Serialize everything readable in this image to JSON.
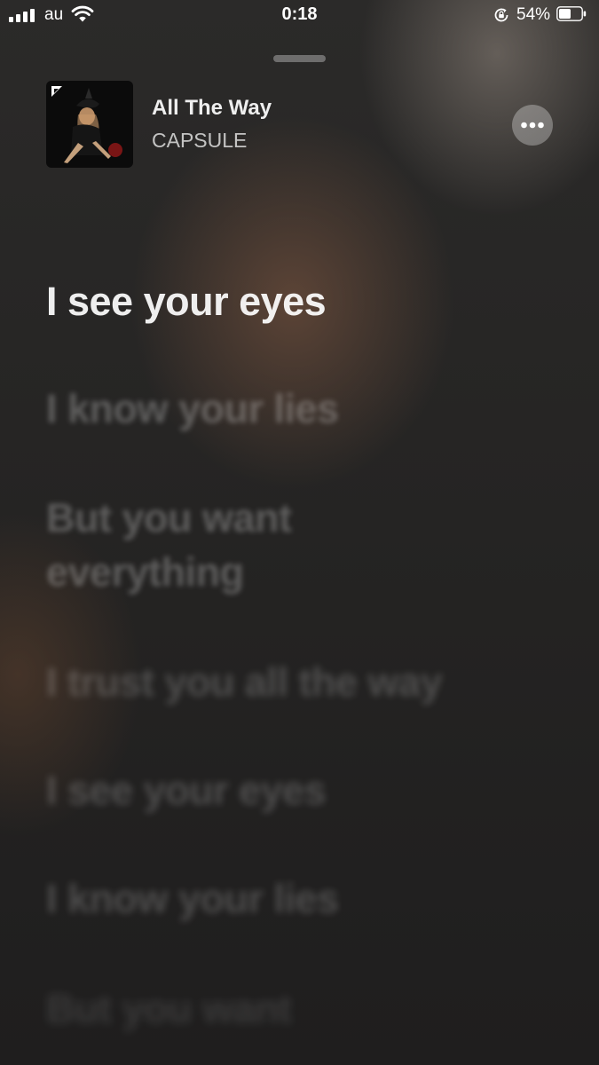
{
  "status_bar": {
    "carrier": "au",
    "time": "0:18",
    "battery_percent": "54%",
    "battery_level": 0.54,
    "signal_bars": 4
  },
  "now_playing": {
    "title": "All The Way",
    "artist": "CAPSULE",
    "artwork_icon": "album-artwork-image",
    "more_icon": "ellipsis-icon"
  },
  "lyrics": {
    "lines": [
      "I see your eyes",
      "I know your lies",
      "But you want",
      "everything",
      "I trust you all the way",
      "I see your eyes",
      "I know your lies",
      "But you want"
    ],
    "active_index": 0
  },
  "colors": {
    "accent_bg_warm": "#6e4e3c",
    "text_primary": "#ffffff"
  }
}
